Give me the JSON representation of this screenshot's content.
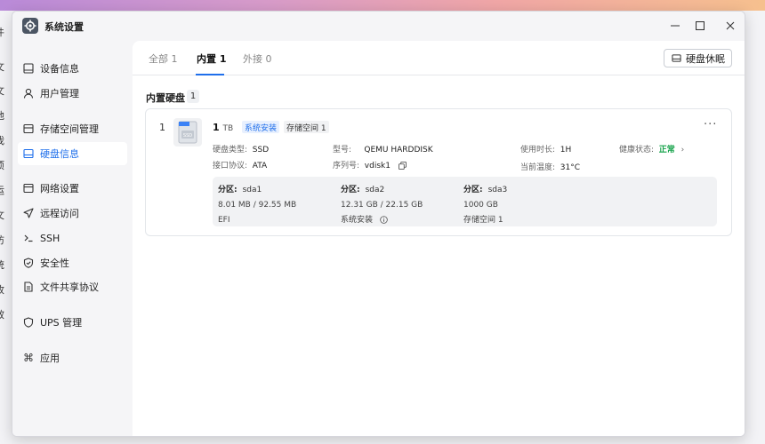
{
  "desktop": {
    "left_fragments": [
      "件",
      "文",
      "文",
      "他",
      "我",
      "项",
      "运",
      "文",
      "访",
      "统",
      "收",
      "效"
    ]
  },
  "window": {
    "title": "系统设置"
  },
  "sidebar": {
    "items": [
      {
        "label": "设备信息",
        "icon": "display-icon"
      },
      {
        "label": "用户管理",
        "icon": "user-icon"
      },
      {
        "label": "存储空间管理",
        "icon": "storage-icon"
      },
      {
        "label": "硬盘信息",
        "icon": "disk-icon"
      },
      {
        "label": "网络设置",
        "icon": "network-icon"
      },
      {
        "label": "远程访问",
        "icon": "send-icon"
      },
      {
        "label": "SSH",
        "icon": "terminal-icon"
      },
      {
        "label": "安全性",
        "icon": "shield-icon"
      },
      {
        "label": "文件共享协议",
        "icon": "file-icon"
      },
      {
        "label": "UPS 管理",
        "icon": "power-icon"
      },
      {
        "label": "应用",
        "icon": "command-icon"
      }
    ],
    "active": "硬盘信息"
  },
  "tabs": [
    {
      "label": "全部 1"
    },
    {
      "label": "内置 1"
    },
    {
      "label": "外接 0"
    }
  ],
  "toolbar": {
    "sleep_label": "硬盘休眠"
  },
  "section": {
    "title": "内置硬盘",
    "count": "1"
  },
  "disk": {
    "index": "1",
    "size": "1",
    "size_unit": "TB",
    "tag_system": "系统安装",
    "tag_storage": "存储空间 1",
    "more": "···",
    "type_label": "硬盘类型:",
    "type_value": "SSD",
    "interface_label": "接口协议:",
    "interface_value": "ATA",
    "model_label": "型号:",
    "model_value": "QEMU HARDDISK",
    "serial_label": "序列号:",
    "serial_value": "vdisk1",
    "uptime_label": "使用时长:",
    "uptime_value": "1H",
    "temp_label": "当前温度:",
    "temp_value": "31°C",
    "health_label": "健康状态:",
    "health_value": "正常",
    "health_color": "#16a34a",
    "image_label": "SSD"
  },
  "partitions": [
    {
      "label": "分区:",
      "name": "sda1",
      "usage": "8.01 MB / 92.55 MB",
      "desc": "EFI"
    },
    {
      "label": "分区:",
      "name": "sda2",
      "usage": "12.31 GB / 22.15 GB",
      "desc": "系统安装"
    },
    {
      "label": "分区:",
      "name": "sda3",
      "usage": "1000 GB",
      "desc": "存储空间 1"
    }
  ],
  "colors": {
    "accent": "#1f6feb"
  }
}
